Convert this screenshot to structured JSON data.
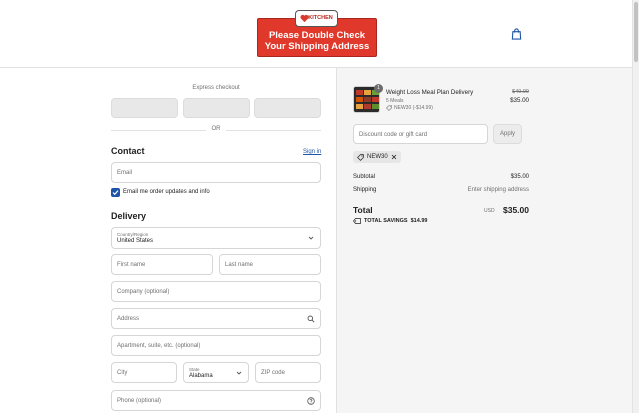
{
  "header": {
    "logo_text": "KITCHEN",
    "banner_line1": "Please Double Check",
    "banner_line2": "Your Shipping Address",
    "cart_icon": "shopping-bag-icon"
  },
  "express": {
    "title": "Express checkout",
    "or_label": "OR"
  },
  "contact": {
    "title": "Contact",
    "sign_in": "Sign in",
    "email_placeholder": "Email",
    "email_updates_label": "Email me order updates and info",
    "email_updates_checked": true
  },
  "delivery": {
    "title": "Delivery",
    "country_label": "Country/Region",
    "country_value": "United States",
    "first_name_placeholder": "First name",
    "last_name_placeholder": "Last name",
    "company_placeholder": "Company (optional)",
    "address_placeholder": "Address",
    "apartment_placeholder": "Apartment, suite, etc. (optional)",
    "city_placeholder": "City",
    "state_label": "State",
    "state_value": "Alabama",
    "zip_placeholder": "ZIP code",
    "phone_placeholder": "Phone (optional)"
  },
  "summary": {
    "product": {
      "quantity": "1",
      "name": "Weight Loss Meal Plan Delivery",
      "variant": "5 Meals",
      "discount": "NEW30 (-$14.99)",
      "original_price": "$49.99",
      "price": "$35.00"
    },
    "discount_placeholder": "Discount code or gift card",
    "apply_label": "Apply",
    "applied_code": "NEW30",
    "subtotal_label": "Subtotal",
    "subtotal_value": "$35.00",
    "shipping_label": "Shipping",
    "shipping_value": "Enter shipping address",
    "total_label": "Total",
    "currency": "USD",
    "total_value": "$35.00",
    "savings_label": "TOTAL SAVINGS",
    "savings_value": "$14.99"
  },
  "colors": {
    "banner_red": "#e0382a",
    "link_blue": "#1f55a6",
    "summary_bg": "#f5f5f5"
  }
}
